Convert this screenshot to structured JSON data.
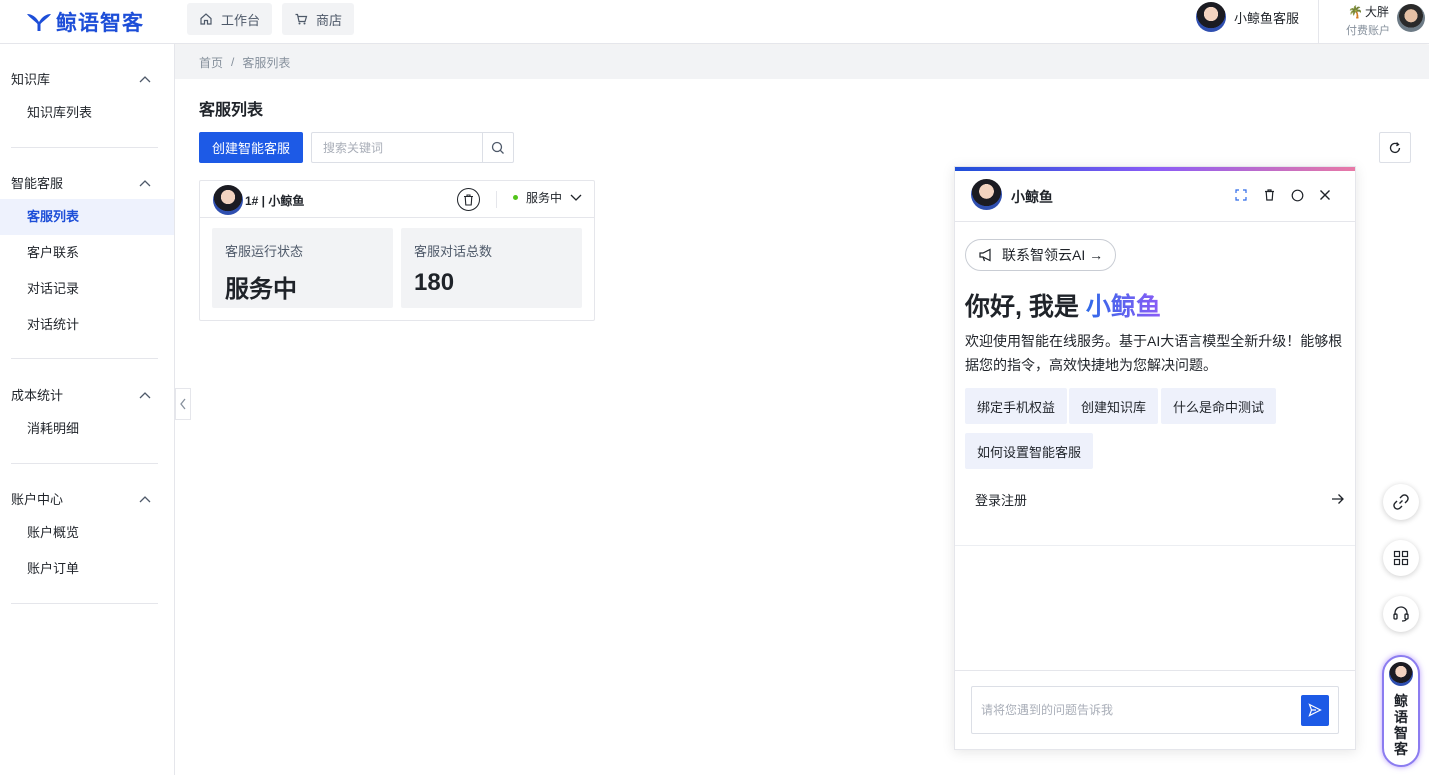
{
  "header": {
    "logo_text": "鲸语智客",
    "tabs": [
      {
        "label": "工作台",
        "icon": "home-icon"
      },
      {
        "label": "商店",
        "icon": "cart-icon"
      }
    ],
    "service_name": "小鲸鱼客服",
    "user_name": "大胖",
    "user_account_type": "付费账户"
  },
  "sidebar": {
    "groups": [
      {
        "title": "知识库",
        "items": [
          "知识库列表"
        ]
      },
      {
        "title": "智能客服",
        "items": [
          "客服列表",
          "客户联系",
          "对话记录",
          "对话统计"
        ]
      },
      {
        "title": "成本统计",
        "items": [
          "消耗明细"
        ]
      },
      {
        "title": "账户中心",
        "items": [
          "账户概览",
          "账户订单"
        ]
      }
    ],
    "active_item": "客服列表"
  },
  "breadcrumb": {
    "home": "首页",
    "separator": "/",
    "current": "客服列表"
  },
  "main": {
    "title": "客服列表",
    "create_button": "创建智能客服",
    "search_placeholder": "搜索关键词",
    "card": {
      "name": "1# | 小鲸鱼",
      "status": "服务中",
      "status_color": "#52c41a",
      "stats": [
        {
          "label": "客服运行状态",
          "value": "服务中"
        },
        {
          "label": "客服对话总数",
          "value": "180"
        }
      ]
    }
  },
  "chat": {
    "bot_name": "小鲸鱼",
    "contact_pill": "联系智领云AI →",
    "greeting_prefix": "你好, 我是 ",
    "greeting_name": "小鲸鱼",
    "welcome": "欢迎使用智能在线服务。基于AI大语言模型全新升级！能够根据您的指令，高效快捷地为您解决问题。",
    "suggestions": [
      "绑定手机权益",
      "创建知识库",
      "什么是命中测试",
      "如何设置智能客服"
    ],
    "login_label": "登录注册",
    "input_placeholder": "请将您遇到的问题告诉我"
  },
  "floating": {
    "brand_vertical": [
      "鲸",
      "语",
      "智",
      "客"
    ],
    "buttons": [
      "link-icon",
      "grid-icon",
      "headset-icon"
    ]
  },
  "colors": {
    "accent": "#1d5ae6",
    "brand": "#1d4ed8"
  }
}
